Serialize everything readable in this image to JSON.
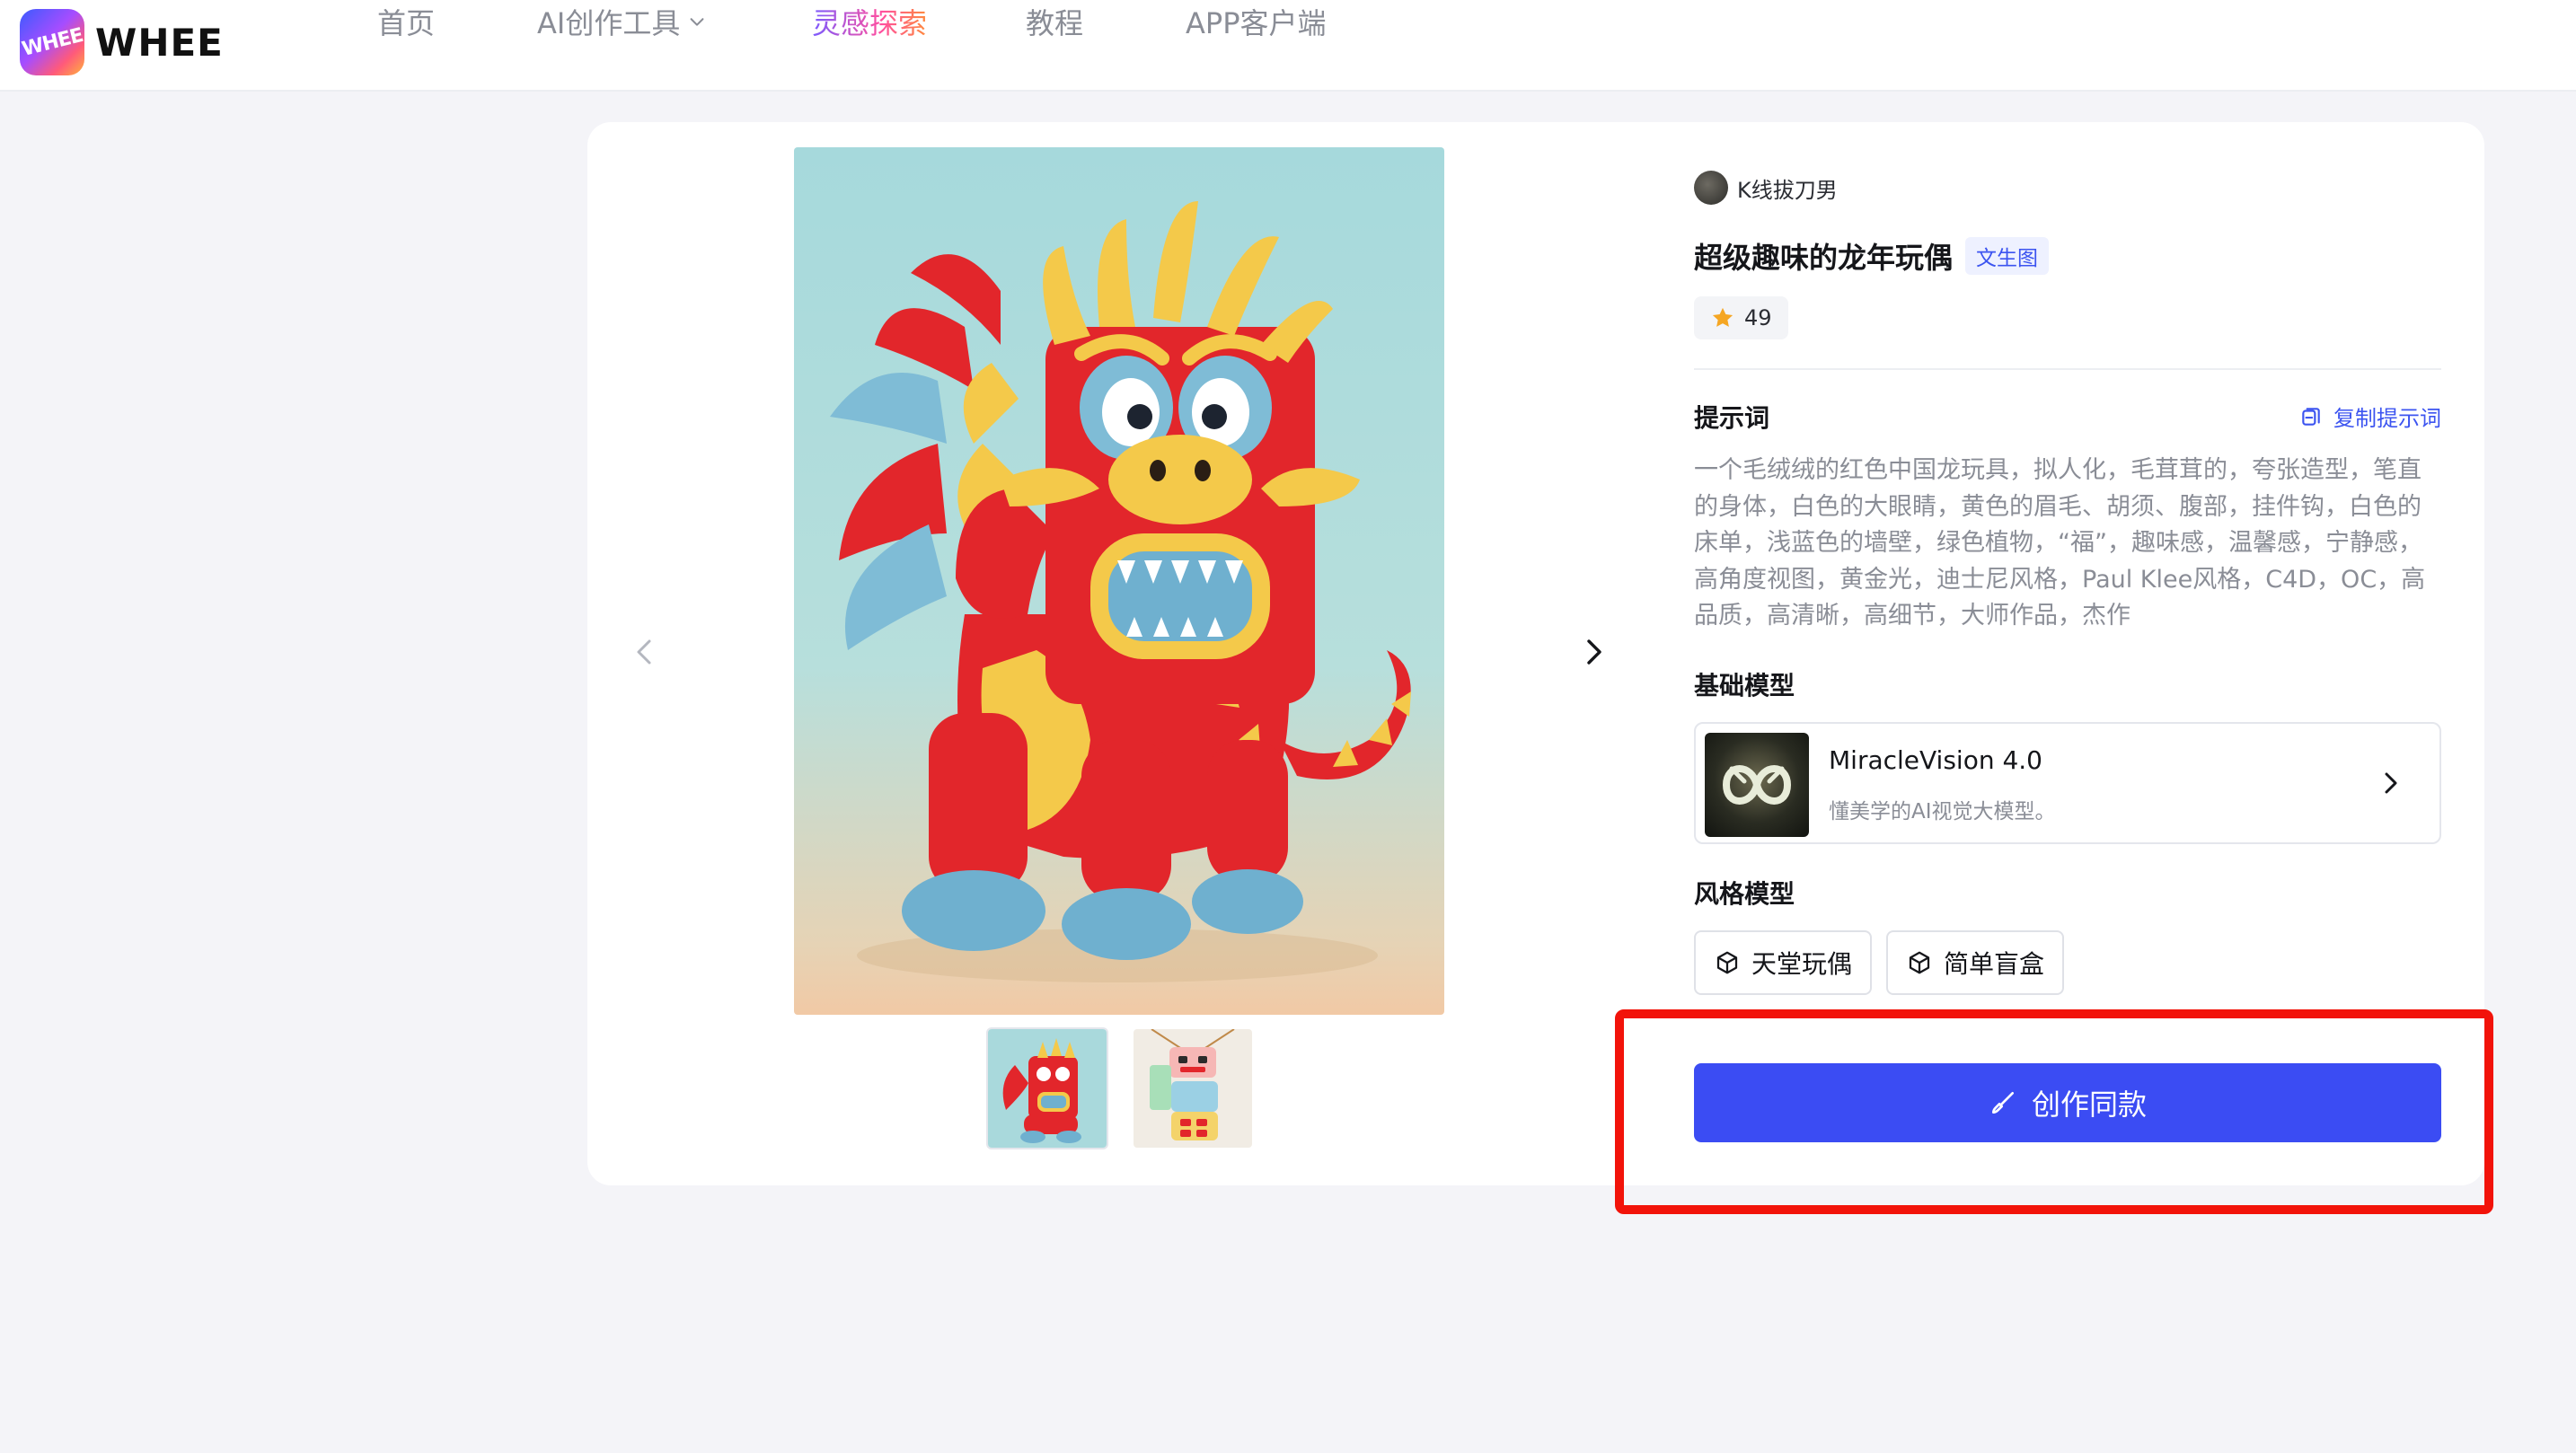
{
  "brand": {
    "name": "WHEE",
    "mark_text": "WHEE"
  },
  "nav": {
    "home": "首页",
    "tools": "AI创作工具",
    "explore": "灵感探索",
    "tutorial": "教程",
    "app": "APP客户端"
  },
  "work": {
    "author": "K线拔刀男",
    "title": "超级趣味的龙年玩偶",
    "tag": "文生图",
    "likes": "49"
  },
  "prompt": {
    "heading": "提示词",
    "copy_label": "复制提示词",
    "text": "一个毛绒绒的红色中国龙玩具，拟人化，毛茸茸的，夸张造型，笔直的身体，白色的大眼睛，黄色的眉毛、胡须、腹部，挂件钩，白色的床单，浅蓝色的墙壁，绿色植物，“福”，趣味感，温馨感，宁静感，高角度视图，黄金光，迪士尼风格，Paul Klee风格，C4D，OC，高品质，高清晰，高细节，大师作品，杰作"
  },
  "base_model": {
    "heading": "基础模型",
    "name": "MiracleVision 4.0",
    "desc": "懂美学的AI视觉大模型。"
  },
  "style_model": {
    "heading": "风格模型",
    "items": [
      "天堂玩偶",
      "简单盲盒"
    ]
  },
  "create_button": "创作同款",
  "colors": {
    "accent": "#3b4cf3",
    "highlight": "#f2130a",
    "tag_bg": "#eef1ff"
  }
}
